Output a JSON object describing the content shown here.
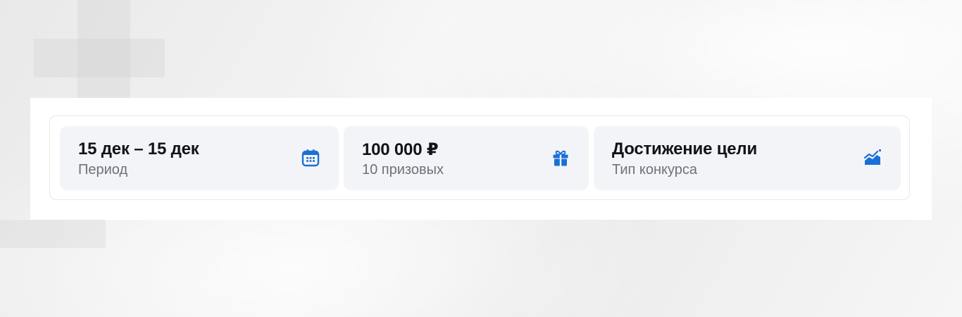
{
  "colors": {
    "accent": "#1a6fd6",
    "card_bg": "#f3f4f7",
    "title": "#111318",
    "subtitle": "#6c717c"
  },
  "stats": [
    {
      "title": "15 дек – 15 дек",
      "subtitle": "Период",
      "icon": "calendar-icon"
    },
    {
      "title": "100 000 ₽",
      "subtitle": "10 призовых",
      "icon": "gift-icon"
    },
    {
      "title": "Достижение цели",
      "subtitle": "Тип конкурса",
      "icon": "chart-growth-icon"
    }
  ]
}
